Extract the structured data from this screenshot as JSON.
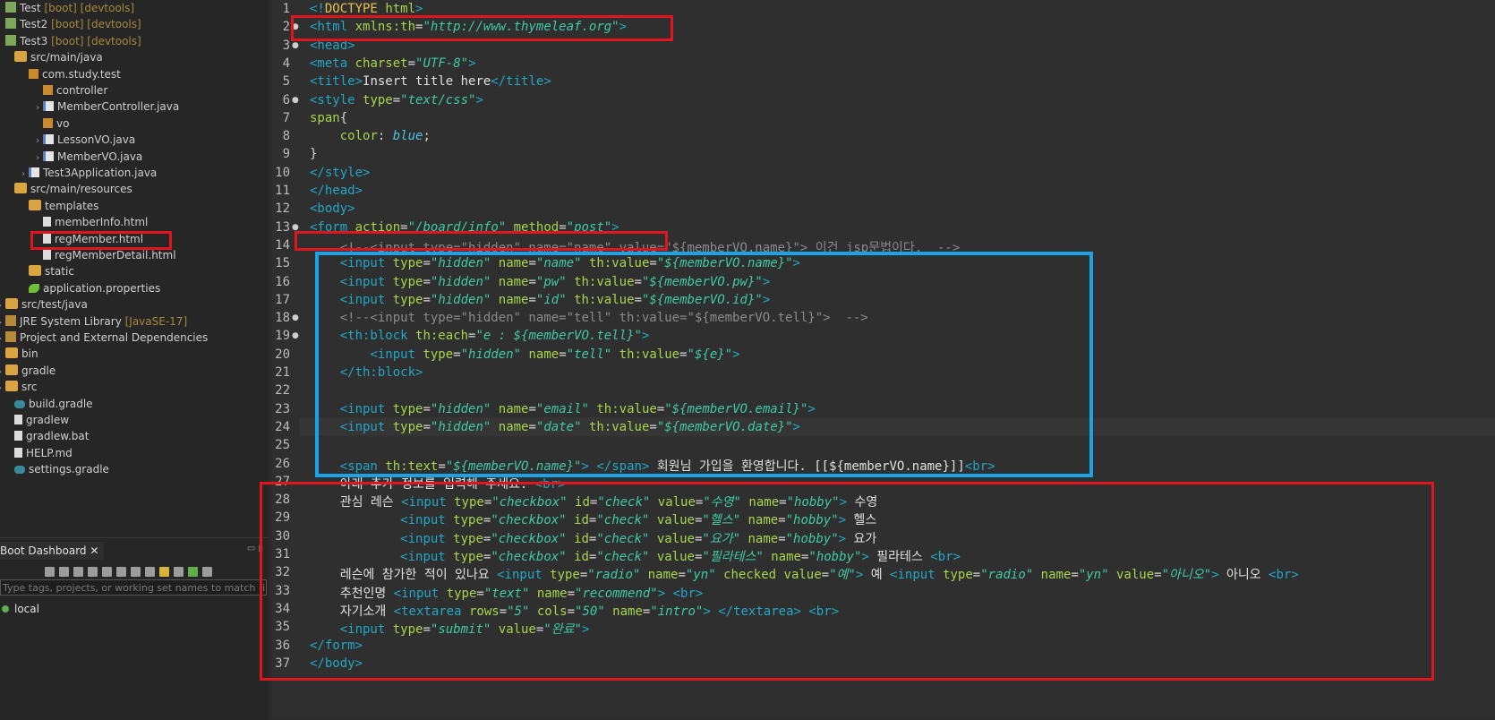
{
  "explorer": {
    "items": [
      {
        "label": "Test",
        "decor": " [boot] [devtools]"
      },
      {
        "label": "Test2",
        "decor": " [boot] [devtools]"
      },
      {
        "label": "Test3",
        "decor": " [boot] [devtools]"
      },
      {
        "label": "src/main/java",
        "decor": ""
      },
      {
        "label": "com.study.test",
        "decor": ""
      },
      {
        "label": "controller",
        "decor": ""
      },
      {
        "label": "MemberController.java",
        "decor": ""
      },
      {
        "label": "vo",
        "decor": ""
      },
      {
        "label": "LessonVO.java",
        "decor": ""
      },
      {
        "label": "MemberVO.java",
        "decor": ""
      },
      {
        "label": "Test3Application.java",
        "decor": ""
      },
      {
        "label": "src/main/resources",
        "decor": ""
      },
      {
        "label": "templates",
        "decor": ""
      },
      {
        "label": "memberInfo.html",
        "decor": ""
      },
      {
        "label": "regMember.html",
        "decor": ""
      },
      {
        "label": "regMemberDetail.html",
        "decor": ""
      },
      {
        "label": "static",
        "decor": ""
      },
      {
        "label": "application.properties",
        "decor": ""
      },
      {
        "label": "src/test/java",
        "decor": ""
      },
      {
        "label": "JRE System Library",
        "decor": " [JavaSE-17]"
      },
      {
        "label": "Project and External Dependencies",
        "decor": ""
      },
      {
        "label": "bin",
        "decor": ""
      },
      {
        "label": "gradle",
        "decor": ""
      },
      {
        "label": "src",
        "decor": ""
      },
      {
        "label": "build.gradle",
        "decor": ""
      },
      {
        "label": "gradlew",
        "decor": ""
      },
      {
        "label": "gradlew.bat",
        "decor": ""
      },
      {
        "label": "HELP.md",
        "decor": ""
      },
      {
        "label": "settings.gradle",
        "decor": ""
      }
    ]
  },
  "dashboard": {
    "tab_label": "Boot Dashboard",
    "filter_placeholder": "Type tags, projects, or working set names to match (incl. ...",
    "local_label": "local"
  },
  "editor": {
    "line_numbers": [
      "1",
      "2",
      "3",
      "4",
      "5",
      "6",
      "7",
      "8",
      "9",
      "10",
      "11",
      "12",
      "13",
      "14",
      "15",
      "16",
      "17",
      "18",
      "19",
      "20",
      "21",
      "22",
      "23",
      "24",
      "25",
      "26",
      "27",
      "28",
      "29",
      "30",
      "31",
      "32",
      "33",
      "34",
      "35",
      "36",
      "37"
    ],
    "current_line": "24"
  }
}
